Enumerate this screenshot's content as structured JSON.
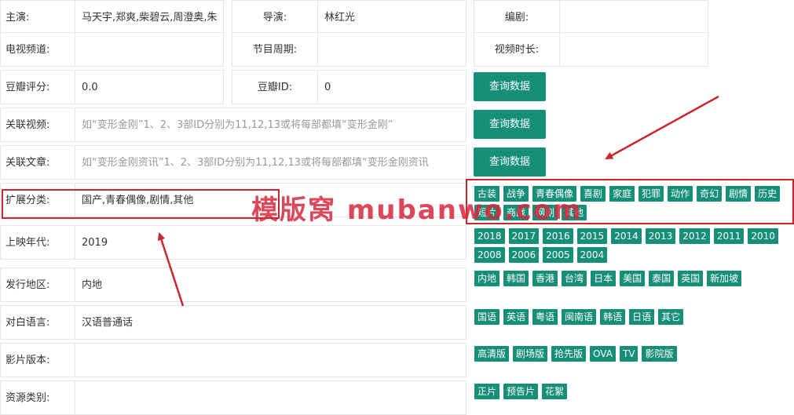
{
  "form": {
    "row1": {
      "actor_label": "主演:",
      "actor_value": "马天宇,郑爽,柴碧云,周澄奥,朱",
      "director_label": "导演:",
      "director_value": "林红光",
      "writer_label": "编剧:"
    },
    "row2": {
      "channel_label": "电视频道:",
      "period_label": "节目周期:",
      "duration_label": "视频时长:"
    },
    "row3": {
      "douban_score_label": "豆瓣评分:",
      "douban_score_value": "0.0",
      "douban_id_label": "豆瓣ID:",
      "douban_id_value": "0",
      "query_label": "查询数据"
    },
    "row4": {
      "label": "关联视频:",
      "placeholder": "如“变形金刚”1、2、3部ID分别为11,12,13或将每部都填“变形金刚”",
      "query_label": "查询数据"
    },
    "row5": {
      "label": "关联文章:",
      "placeholder": "如“变形金刚资讯”1、2、3部ID分别为11,12,13或将每部都填“变形金刚资讯",
      "query_label": "查询数据"
    },
    "row6": {
      "label": "扩展分类:",
      "value": "国产,青春偶像,剧情,其他"
    },
    "row7": {
      "label": "上映年代:",
      "value": "2019"
    },
    "row8": {
      "label": "发行地区:",
      "value": "内地"
    },
    "row9": {
      "label": "对白语言:",
      "value": "汉语普通话"
    },
    "row10": {
      "label": "影片版本:"
    },
    "row11": {
      "label": "资源类别:"
    }
  },
  "tags": {
    "genres": [
      "古装",
      "战争",
      "青春偶像",
      "喜剧",
      "家庭",
      "犯罪",
      "动作",
      "奇幻",
      "剧情",
      "历史",
      "短片",
      "商战",
      "网剧",
      "其他"
    ],
    "years": [
      "2018",
      "2017",
      "2016",
      "2015",
      "2014",
      "2013",
      "2012",
      "2011",
      "2010",
      "2008",
      "2006",
      "2005",
      "2004"
    ],
    "regions": [
      "内地",
      "韩国",
      "香港",
      "台湾",
      "日本",
      "美国",
      "泰国",
      "英国",
      "新加坡"
    ],
    "languages": [
      "国语",
      "英语",
      "粤语",
      "闽南语",
      "韩语",
      "日语",
      "其它"
    ],
    "versions": [
      "高清版",
      "剧场版",
      "抢先版",
      "OVA",
      "TV",
      "影院版"
    ],
    "resource_types": [
      "正片",
      "预告片",
      "花絮"
    ]
  },
  "watermark": "模版窝 mubanwo.com",
  "colors": {
    "accent": "#168f78",
    "annotation_red": "#c8282b"
  }
}
